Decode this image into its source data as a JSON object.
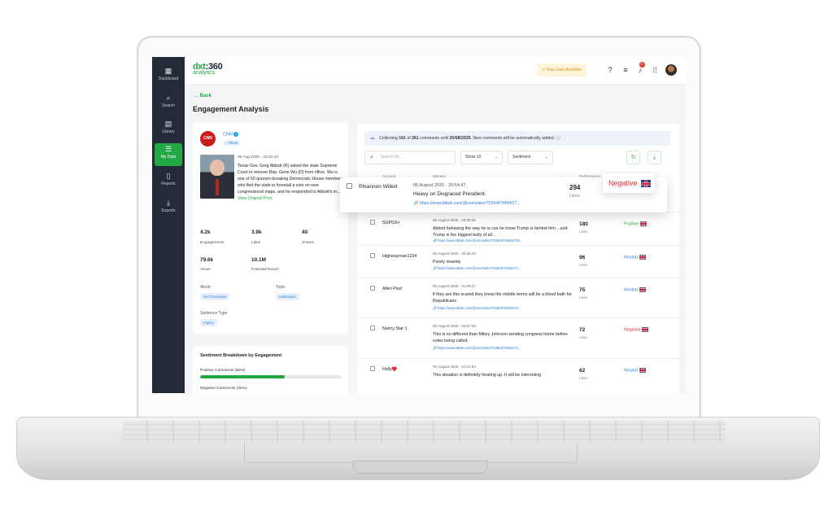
{
  "sidebar": {
    "items": [
      {
        "label": "Dashboard",
        "icon": "grid-icon"
      },
      {
        "label": "Search",
        "icon": "search-icon"
      },
      {
        "label": "Library",
        "icon": "clipboard-icon"
      },
      {
        "label": "My Data",
        "icon": "list-icon",
        "active": true
      },
      {
        "label": "Reports",
        "icon": "document-icon"
      },
      {
        "label": "Exports",
        "icon": "download-icon"
      }
    ]
  },
  "header": {
    "logo_dx": "dxt",
    "logo_num": ":360",
    "logo_sub": "analytics",
    "new_data": "New Data Available",
    "bell_count": "9+"
  },
  "page": {
    "back": "Back",
    "title": "Engagement Analysis"
  },
  "post": {
    "source": "CNN",
    "account": "CNN",
    "platform": "Tiktok",
    "date": "06 Aug 2025 - 20:42:43",
    "text": "Texas Gov. Greg Abbott (R) asked the state Supreme Court to remove Rep. Gene Wu (D) from office. Wu is one of 50 quorum-breaking Democratic House members who fled the state to forestall a vote on new congressional maps, and he responded to Abbott's m...",
    "view_link": "View Original Post",
    "stats": [
      {
        "value": "4.2k",
        "label": "Engagements"
      },
      {
        "value": "3.9k",
        "label": "Likes"
      },
      {
        "value": "40",
        "label": "Shares"
      },
      {
        "value": "79.6k",
        "label": "Views"
      },
      {
        "value": "10.1M",
        "label": "Potential Reach"
      }
    ],
    "mood_label": "Mood",
    "mood_value": "Not Frustration",
    "topic_label": "Topic",
    "topic_value": "Institutions",
    "sentence_label": "Sentence Type",
    "sentence_value": "Inquiry"
  },
  "sentiment": {
    "title": "Sentiment Breakdown by Engagement",
    "positive_label": "Positive Comments (60%)",
    "positive_fraction": 0.6,
    "negative_label": "Negative Comments (35%)"
  },
  "comments": {
    "collect_prefix": "Collecting ",
    "collected": "161",
    "collect_of": " of ",
    "total": "261",
    "collect_until": " comments until ",
    "until_date": "20/08/2025.",
    "collect_suffix": " New comments will be automatically added.",
    "search_placeholder": "Search for...",
    "show_select": "Show 10",
    "sentiment_select": "Sentiment",
    "col_account": "Account",
    "col_mention": "Mention",
    "col_performance": "Performance",
    "highlight": {
      "author": "Rhiannon Willert",
      "date": "06 August 2025 - 20:54:47",
      "text": "Heavy on Disgraced President.",
      "url": "https://www.tiktok.com/@cnn/video/75354674845​27...",
      "likes": "294",
      "likes_label": "Likes",
      "sentiment": "Negative"
    },
    "rows": [
      {
        "author": "SGP52H",
        "date": "06 August 2025 - 20:55:33",
        "text": "Abbott behaving the way he is cos he know Trump is behind him... and Trump is the biggest bully of all...",
        "url": "https://www.tiktok.com/@cnn/video/753546748452728...",
        "likes": "180",
        "likes_label": "Likes",
        "sentiment": "Positive"
      },
      {
        "author": "Highwayman1234",
        "date": "06 August 2025 - 20:45:43",
        "text": "Purely insanity",
        "url": "https://www.tiktok.com/@cnn/video/75354674845272...",
        "likes": "96",
        "likes_label": "Likes",
        "sentiment": "Neutral"
      },
      {
        "author": "Allen Paul",
        "date": "06 August 2025 - 21:09:27",
        "text": "if they are this scared they know the middle terms will be a blood bath for Republicans",
        "url": "https://www.tiktok.com/@cnn/video/75354674845272...",
        "likes": "75",
        "likes_label": "Likes",
        "sentiment": "Neutral"
      },
      {
        "author": "Nancy Star 1",
        "date": "06 August 2025 - 20:57:29",
        "text": "This is no different than Mikey Johnson sending congress home before votes being called.",
        "url": "https://www.tiktok.com/@cnn/video/75354674845272...",
        "likes": "72",
        "likes_label": "Likes",
        "sentiment": "Negative"
      },
      {
        "author": "Holly♥️",
        "date": "06 August 2025 - 21:01:53",
        "text": "This situation is definitely heating up. It will be interesting",
        "url": "https://www.tiktok.com/@cnn/video/753546748452728...",
        "likes": "62",
        "likes_label": "Likes",
        "sentiment": "Neutral"
      }
    ]
  }
}
